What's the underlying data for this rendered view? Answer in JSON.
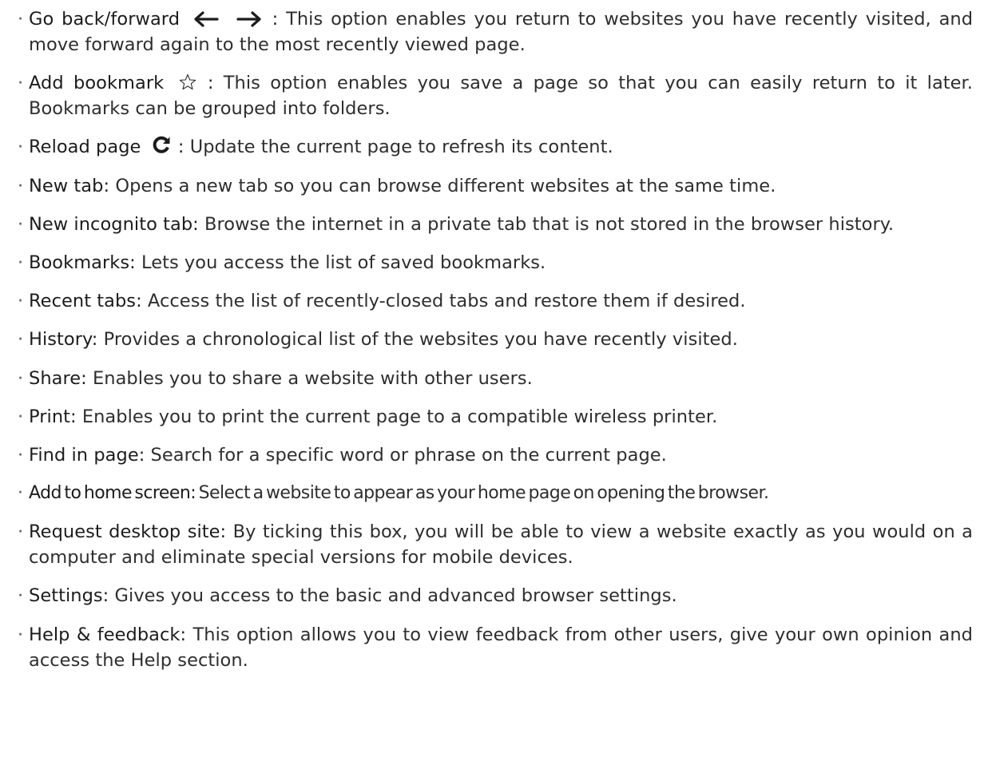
{
  "bullet": "·",
  "items": [
    {
      "term": "Go back/forward",
      "icons": [
        "arrow-left-icon",
        "arrow-right-icon"
      ],
      "sep": ":",
      "desc": "This option enables you return to websites you have recently visited, and move forward again to the most recently viewed page."
    },
    {
      "term": "Add bookmark",
      "icons": [
        "star-outline-icon"
      ],
      "sep": ":",
      "desc": "This option enables you save a page so that you can easily return to it later. Bookmarks can be grouped into folders."
    },
    {
      "term": "Reload page",
      "icons": [
        "reload-icon"
      ],
      "sep": ":",
      "desc": "Update the current page to refresh its content."
    },
    {
      "term": "New tab:",
      "desc": "Opens a new tab so you can browse different websites at the same time."
    },
    {
      "term": "New incognito tab:",
      "desc": "Browse the internet in a private tab that is not stored in the browser history."
    },
    {
      "term": "Bookmarks:",
      "desc": "Lets you access the list of saved bookmarks."
    },
    {
      "term": "Recent tabs:",
      "desc": "Access the list of recently-closed tabs and restore them if desired."
    },
    {
      "term": "History:",
      "desc": "Provides a chronological list of the websites you have recently visited."
    },
    {
      "term": "Share:",
      "desc": "Enables you to share a website with other users."
    },
    {
      "term": "Print:",
      "desc": "Enables you to print the current page to a compatible wireless printer."
    },
    {
      "term": "Find in page:",
      "desc": "Search for a specific word or phrase on the current page."
    },
    {
      "term": "Add to home screen:",
      "desc": "Select a website to appear as your home page on opening the browser."
    },
    {
      "term": "Request desktop site:",
      "desc": "By ticking this box, you will be able to view a website exactly as you would on a computer and eliminate special versions for mobile devices."
    },
    {
      "term": "Settings:",
      "desc": "Gives you access to the basic and advanced browser settings."
    },
    {
      "term": "Help & feedback:",
      "desc": "This option allows you to view feedback from other users, give your own opinion and access the Help section."
    }
  ]
}
